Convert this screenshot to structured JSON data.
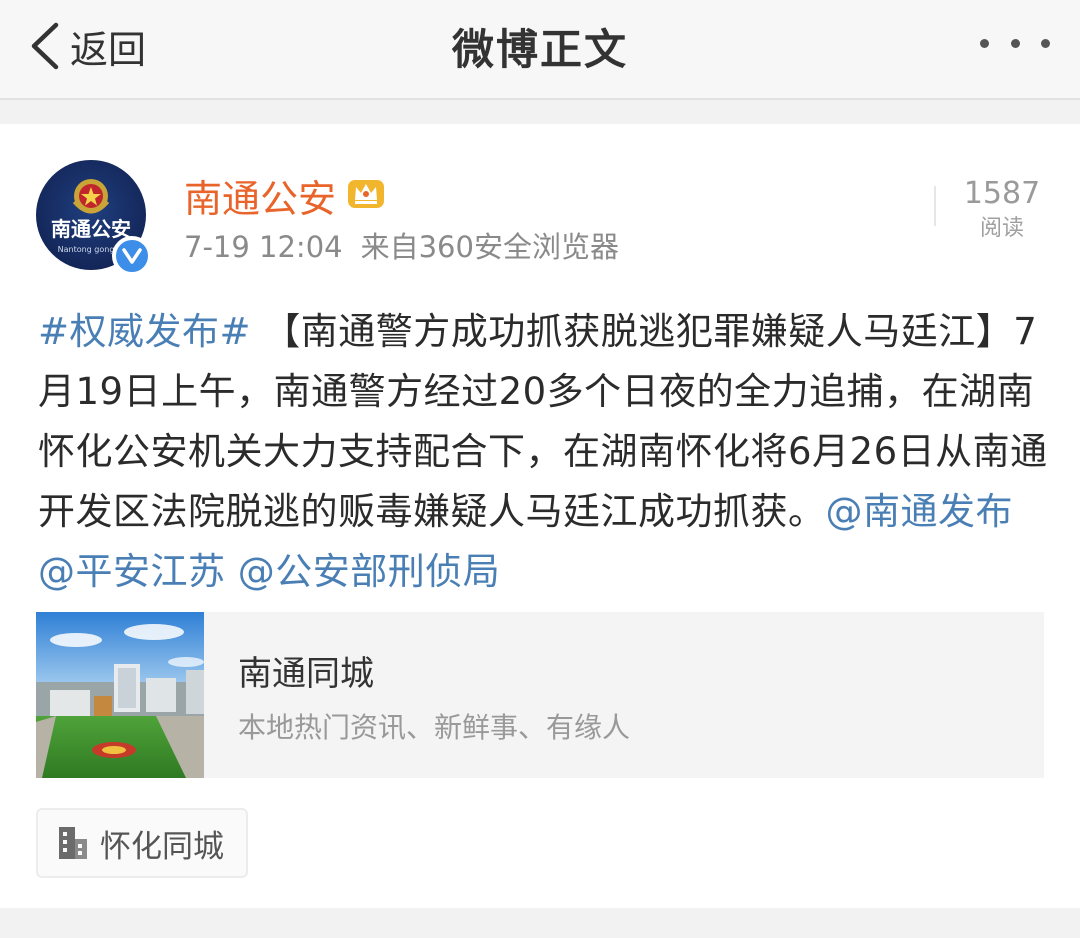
{
  "navbar": {
    "back_label": "返回",
    "title": "微博正文"
  },
  "post": {
    "author": "南通公安",
    "avatar_text": "南通公安",
    "avatar_subtext": "Nantong gongan",
    "time": "7-19 12:04",
    "source": "来自360安全浏览器",
    "read_count": "1587",
    "read_label": "阅读",
    "body": {
      "hashtag": "#权威发布#",
      "headline": "【南通警方成功抓获脱逃犯罪嫌疑人马廷江】",
      "text": "7月19日上午，南通警方经过20多个日夜的全力追捕，在湖南怀化公安机关大力支持配合下，在湖南怀化将6月26日从南通开发区法院脱逃的贩毒嫌疑人马廷江成功抓获。",
      "mentions": [
        "@南通发布",
        "@平安江苏",
        "@公安部刑侦局"
      ]
    }
  },
  "location_card": {
    "title": "南通同城",
    "description": "本地热门资讯、新鲜事、有缘人"
  },
  "place_tag": {
    "label": "怀化同城"
  },
  "colors": {
    "username": "#e8642a",
    "link": "#4a7fb5",
    "verified": "#3d8ee8"
  }
}
